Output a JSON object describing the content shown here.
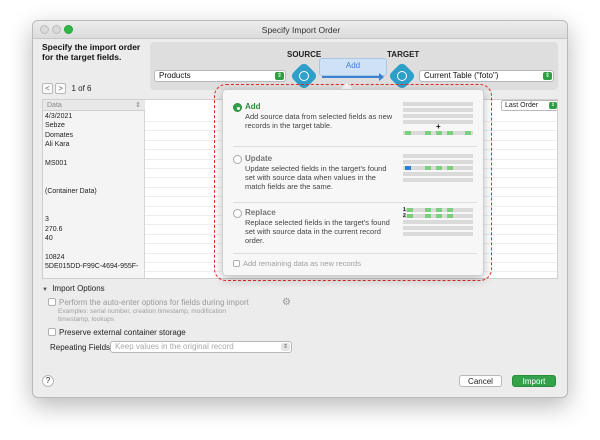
{
  "window": {
    "title": "Specify Import Order",
    "heading": "Specify the import order for the target fields."
  },
  "mapping": {
    "source_label": "SOURCE",
    "target_label": "TARGET",
    "source_select": "Products",
    "target_select": "Current Table (\"foto\")",
    "action_button": "Add"
  },
  "nav": {
    "prev": "<",
    "next": ">",
    "record_count": "1 of 6"
  },
  "table": {
    "source_header": "Data",
    "target_sort": "Last Order",
    "source_cells": [
      "4/3/2021",
      "Sebze",
      "Domates",
      "Ali Kara",
      "",
      "MS001",
      "",
      "",
      "(Container Data)",
      "",
      "",
      "3",
      "270.6",
      "40",
      "",
      "10824",
      "5DE015DD-F99C-4694-955F-"
    ]
  },
  "popover": {
    "options": [
      {
        "title": "Add",
        "desc": "Add source data from selected fields as new records in the target table.",
        "selected": true
      },
      {
        "title": "Update",
        "desc": "Update selected fields in the target's found set with source data when values in the match fields are the same.",
        "selected": false
      },
      {
        "title": "Replace",
        "desc": "Replace selected fields in the target's found set with source data in the current record order.",
        "selected": false
      }
    ],
    "add_remaining": "Add remaining data as new records",
    "plus": "+",
    "row1": "1",
    "row2": "2"
  },
  "import_options": {
    "header": "Import Options",
    "auto_enter": "Perform the auto-enter options for fields during import",
    "examples": "Examples: serial number, creation timestamp, modification timestamp, lookups",
    "preserve": "Preserve external container storage",
    "repeating_label": "Repeating Fields:",
    "repeating_value": "Keep values in the original record"
  },
  "footer": {
    "help": "?",
    "cancel": "Cancel",
    "import": "Import"
  },
  "colors": {
    "accent_green": "#35a24a",
    "accent_blue": "#3a80cf",
    "annotation_red": "#e32a2a"
  }
}
